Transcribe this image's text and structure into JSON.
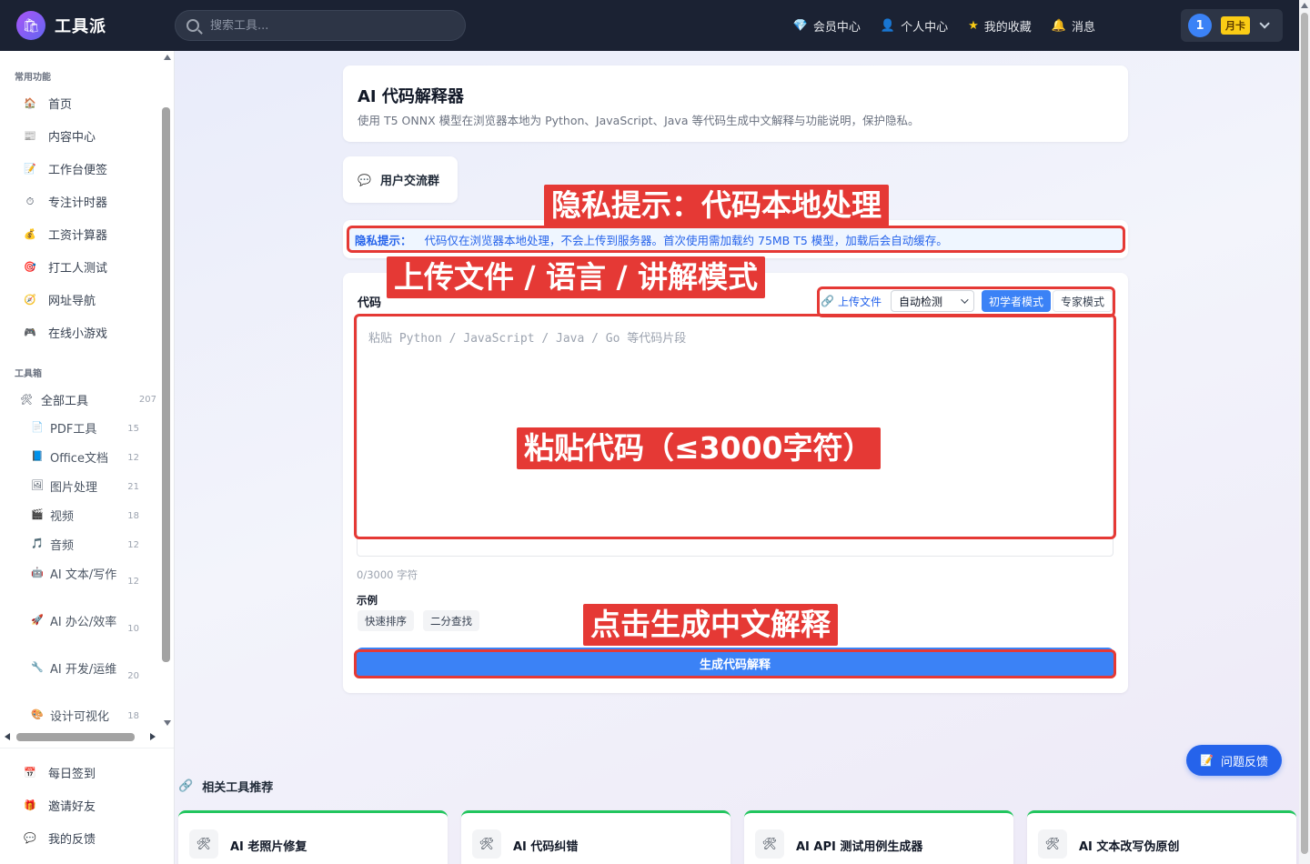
{
  "app": {
    "name": "工具派",
    "search_placeholder": "搜索工具..."
  },
  "topnav": {
    "items": [
      {
        "label": "会员中心",
        "icon": "diamond-icon"
      },
      {
        "label": "个人中心",
        "icon": "user-icon"
      },
      {
        "label": "我的收藏",
        "icon": "star-icon"
      },
      {
        "label": "消息",
        "icon": "bell-icon"
      }
    ],
    "user_avatar": "1",
    "membership_badge": "月卡"
  },
  "sidebar": {
    "common_section": "常用功能",
    "common_items": [
      {
        "label": "首页",
        "icon": "home-icon"
      },
      {
        "label": "内容中心",
        "icon": "newspaper-icon"
      },
      {
        "label": "工作台便签",
        "icon": "memo-icon"
      },
      {
        "label": "专注计时器",
        "icon": "timer-icon"
      },
      {
        "label": "工资计算器",
        "icon": "money-bag-icon"
      },
      {
        "label": "打工人测试",
        "icon": "target-icon"
      },
      {
        "label": "网址导航",
        "icon": "compass-icon"
      },
      {
        "label": "在线小游戏",
        "icon": "gamepad-icon"
      }
    ],
    "toolbox_section": "工具箱",
    "all_tools": {
      "label": "全部工具",
      "count": "207",
      "icon": "tools-icon"
    },
    "tools": [
      {
        "label": "PDF工具",
        "count": "15",
        "icon": "pdf-icon"
      },
      {
        "label": "Office文档",
        "count": "12",
        "icon": "document-icon"
      },
      {
        "label": "图片处理",
        "count": "21",
        "icon": "image-icon"
      },
      {
        "label": "视频",
        "count": "18",
        "icon": "clapper-icon"
      },
      {
        "label": "音频",
        "count": "12",
        "icon": "music-icon"
      },
      {
        "label": "AI 文本/写作",
        "count": "12",
        "icon": "robot-icon"
      },
      {
        "label": "AI 办公/效率",
        "count": "10",
        "icon": "rocket-icon"
      },
      {
        "label": "AI 开发/运维",
        "count": "20",
        "icon": "wrench-icon"
      },
      {
        "label": "设计可视化",
        "count": "18",
        "icon": "palette-icon"
      }
    ],
    "bottom_items": [
      {
        "label": "每日签到",
        "icon": "calendar-icon"
      },
      {
        "label": "邀请好友",
        "icon": "gift-icon"
      },
      {
        "label": "我的反馈",
        "icon": "chat-icon"
      }
    ]
  },
  "page": {
    "title": "AI 代码解释器",
    "subtitle": "使用 T5 ONNX 模型在浏览器本地为 Python、JavaScript、Java 等代码生成中文解释与功能说明，保护隐私。",
    "community_button": "用户交流群",
    "privacy_label": "隐私提示：",
    "privacy_text": "代码仅在浏览器本地处理，不会上传到服务器。首次使用需加载约 75MB T5 模型，加载后会自动缓存。",
    "code_label": "代码",
    "upload_label": "上传文件",
    "language_select": "自动检测",
    "mode_beginner": "初学者模式",
    "mode_expert": "专家模式",
    "code_placeholder": "粘贴 Python / JavaScript / Java / Go 等代码片段",
    "char_counter": "0/3000 字符",
    "examples_label": "示例",
    "examples": [
      "快速排序",
      "二分查找"
    ],
    "generate_button": "生成代码解释",
    "related_title": "相关工具推荐",
    "related_tools": [
      "AI 老照片修复",
      "AI 代码纠错",
      "AI API 测试用例生成器",
      "AI 文本改写伪原创"
    ],
    "feedback_button": "问题反馈"
  },
  "annotations": {
    "privacy": "隐私提示：代码本地处理",
    "toolbar": "上传文件 / 语言 / 讲解模式",
    "code": "粘贴代码（≤3000字符）",
    "generate": "点击生成中文解释",
    "color": "#e53935"
  },
  "colors": {
    "topbar": "#1b2233",
    "accent": "#3b82f6",
    "annotation": "#e53935",
    "badge": "#facc15"
  }
}
